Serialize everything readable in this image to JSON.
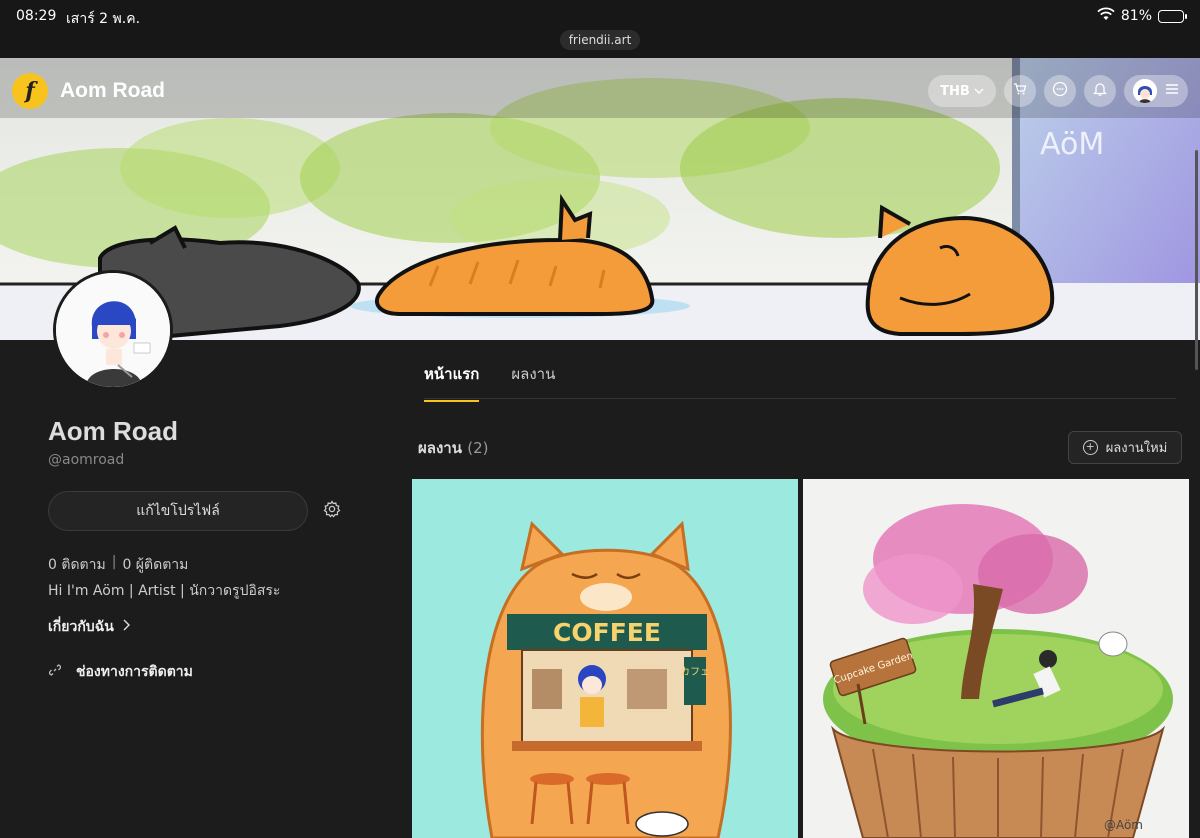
{
  "status": {
    "time": "08:29",
    "date": "เสาร์ 2 พ.ค.",
    "battery": "81%",
    "battery_level": 0.81
  },
  "browser": {
    "url": "friendii.art"
  },
  "header": {
    "logo_text": "f",
    "site_name": "Aom Road",
    "currency": "THB",
    "icons": [
      "cart-icon",
      "chat-icon",
      "bell-icon",
      "menu-icon"
    ]
  },
  "cover": {
    "watermark": "AöM"
  },
  "profile": {
    "name": "Aom Road",
    "handle": "@aomroad",
    "edit_label": "แก้ไขโปรไฟล์",
    "following": "0 ติดตาม",
    "followers": "0 ผู้ติดตาม",
    "separator": "|",
    "bio": "Hi I'm Aöm | Artist | นักวาดรูปอิสระ",
    "about_label": "เกี่ยวกับฉัน",
    "about_arrow": ">",
    "channel_label": "ช่องทางการติดตาม"
  },
  "tabs": [
    {
      "label": "หน้าแรก",
      "active": true
    },
    {
      "label": "ผลงาน",
      "active": false
    }
  ],
  "works": {
    "title": "ผลงาน",
    "count": "(2)",
    "new_label": "ผลงานใหม่",
    "items": [
      {
        "sign_text": "COFFEE",
        "side_sign": "カフェ"
      },
      {
        "sign_text": "Cupcake Garden",
        "signature": "@Aöm"
      }
    ]
  },
  "colors": {
    "accent": "#f7c31c",
    "background": "#1c1c1c",
    "cat_orange": "#f59c3a"
  }
}
